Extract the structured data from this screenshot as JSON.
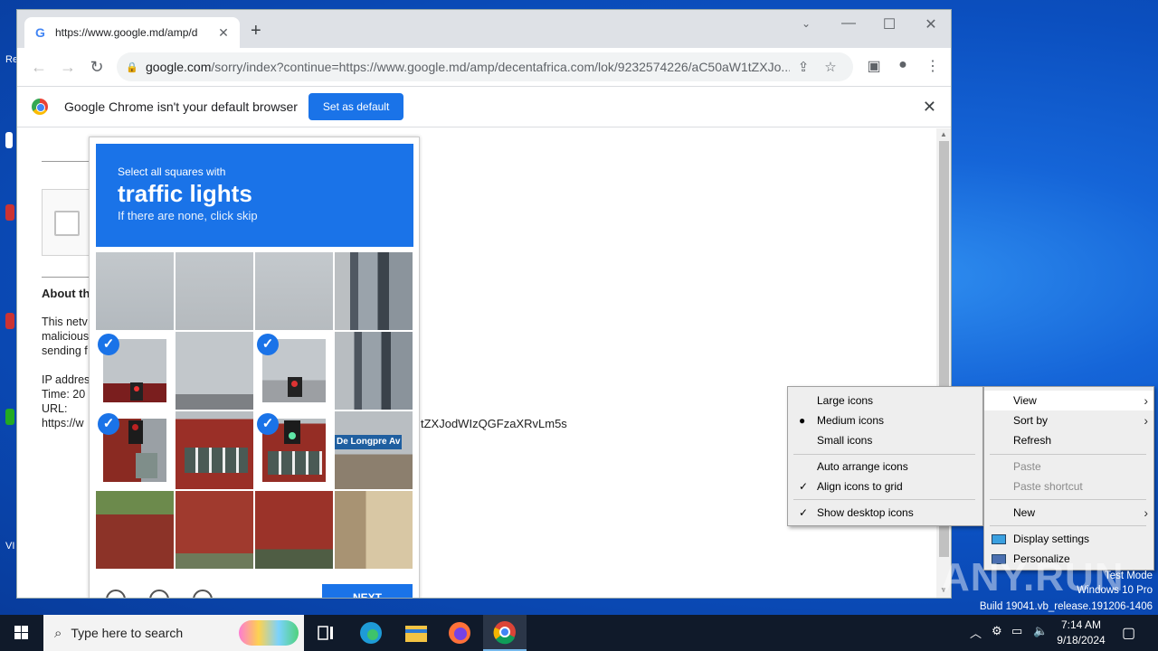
{
  "browser": {
    "tab_title": "https://www.google.md/amp/d",
    "tab_favicon": "G",
    "url_domain": "google.com",
    "url_path": "/sorry/index?continue=https://www.google.md/amp/decentafrica.com/lok/9232574226/aC50aW1tZXJo..."
  },
  "infobar": {
    "message": "Google Chrome isn't your default browser",
    "button": "Set as default"
  },
  "page": {
    "about_heading": "About th",
    "line1": "This netv",
    "line2": "malicious",
    "line3": "sending f",
    "ip_label": "IP addres",
    "time_label": "Time: 20",
    "url_label": "URL:",
    "url_value_left": "https://w",
    "url_value_right": "tZXJodWIzQGFzaXRvLm5s"
  },
  "captcha": {
    "instruction": "Select all squares with",
    "target": "traffic lights",
    "hint": "If there are none, click skip",
    "verify_button": "NEXT",
    "street_sign": "De Longpre Av"
  },
  "context_menu": {
    "main": {
      "view": "View",
      "sort_by": "Sort by",
      "refresh": "Refresh",
      "paste": "Paste",
      "paste_shortcut": "Paste shortcut",
      "new": "New",
      "display_settings": "Display settings",
      "personalize": "Personalize"
    },
    "view_submenu": {
      "large_icons": "Large icons",
      "medium_icons": "Medium icons",
      "small_icons": "Small icons",
      "auto_arrange": "Auto arrange icons",
      "align_grid": "Align icons to grid",
      "show_desktop_icons": "Show desktop icons"
    }
  },
  "watermark": {
    "line1": "Test Mode",
    "line2": "Windows 10 Pro",
    "line3": "Build 19041.vb_release.191206-1406",
    "brand": "ANY.RUN"
  },
  "taskbar": {
    "search_placeholder": "Type here to search",
    "time": "7:14 AM",
    "date": "9/18/2024"
  }
}
